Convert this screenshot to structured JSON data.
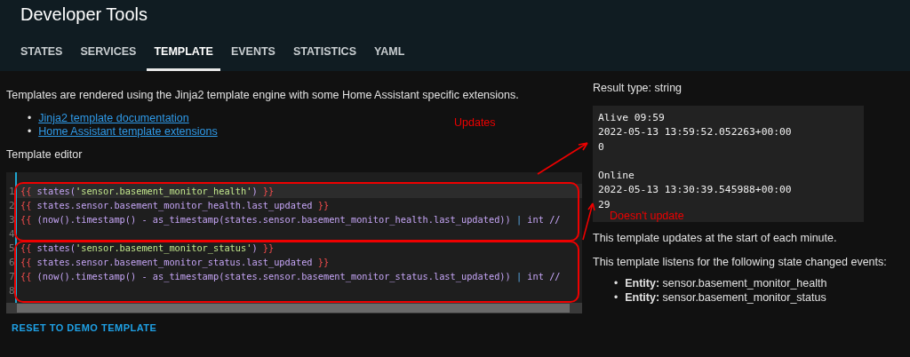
{
  "header": {
    "title": "Developer Tools"
  },
  "tabs": [
    {
      "label": "STATES",
      "selected": false
    },
    {
      "label": "SERVICES",
      "selected": false
    },
    {
      "label": "TEMPLATE",
      "selected": true
    },
    {
      "label": "EVENTS",
      "selected": false
    },
    {
      "label": "STATISTICS",
      "selected": false
    },
    {
      "label": "YAML",
      "selected": false
    }
  ],
  "intro": "Templates are rendered using the Jinja2 template engine with some Home Assistant specific extensions.",
  "links": [
    {
      "marker": "•",
      "text": "Jinja2 template documentation"
    },
    {
      "marker": "•",
      "text": "Home Assistant template extensions"
    }
  ],
  "editor_label": "Template editor",
  "editor": {
    "lines": [
      {
        "number": "1",
        "active": true,
        "segments": [
          {
            "kind": "brace",
            "text": "{{"
          },
          {
            "kind": "code",
            "text": " states("
          },
          {
            "kind": "string",
            "text": "'sensor.basement_monitor_health'"
          },
          {
            "kind": "code",
            "text": ") "
          },
          {
            "kind": "brace",
            "text": "}}"
          }
        ]
      },
      {
        "number": "2",
        "active": false,
        "segments": [
          {
            "kind": "brace",
            "text": "{{"
          },
          {
            "kind": "code",
            "text": " states.sensor.basement_monitor_health.last_updated "
          },
          {
            "kind": "brace",
            "text": "}}"
          }
        ]
      },
      {
        "number": "3",
        "active": false,
        "segments": [
          {
            "kind": "brace",
            "text": "{{"
          },
          {
            "kind": "code",
            "text": " (now().timestamp() - as_timestamp(states.sensor.basement_monitor_health.last_updated)) "
          },
          {
            "kind": "pipe",
            "text": "|"
          },
          {
            "kind": "code",
            "text": " int //"
          }
        ]
      },
      {
        "number": "4",
        "active": false
      },
      {
        "number": "5",
        "active": false,
        "segments": [
          {
            "kind": "brace",
            "text": "{{"
          },
          {
            "kind": "code",
            "text": " states("
          },
          {
            "kind": "string",
            "text": "'sensor.basement_monitor_status'"
          },
          {
            "kind": "code",
            "text": ") "
          },
          {
            "kind": "brace",
            "text": "}}"
          }
        ]
      },
      {
        "number": "6",
        "active": false,
        "segments": [
          {
            "kind": "brace",
            "text": "{{"
          },
          {
            "kind": "code",
            "text": " states.sensor.basement_monitor_status.last_updated "
          },
          {
            "kind": "brace",
            "text": "}}"
          }
        ]
      },
      {
        "number": "7",
        "active": false,
        "segments": [
          {
            "kind": "brace",
            "text": "{{"
          },
          {
            "kind": "code",
            "text": " (now().timestamp() - as_timestamp(states.sensor.basement_monitor_status.last_updated)) "
          },
          {
            "kind": "pipe",
            "text": "|"
          },
          {
            "kind": "code",
            "text": " int //"
          }
        ]
      },
      {
        "number": "8",
        "active": false
      }
    ]
  },
  "reset_button": "RESET TO DEMO TEMPLATE",
  "result": {
    "type_label": "Result type: string",
    "blocks": [
      [
        "Alive 09:59",
        "2022-05-13 13:59:52.052263+00:00",
        "0"
      ],
      [
        "Online",
        "2022-05-13 13:30:39.545988+00:00",
        "29"
      ]
    ]
  },
  "update_note": "This template updates at the start of each minute.",
  "listen_note": "This template listens for the following state changed events:",
  "entities": [
    {
      "marker": "•",
      "text": "**Entity:** sensor.basement_monitor_health"
    },
    {
      "marker": "•",
      "text": "**Entity:** sensor.basement_monitor_status"
    }
  ],
  "annotations": [
    {
      "kind": "updates",
      "text": "Updates"
    },
    {
      "kind": "no-update",
      "text": "Doesn't update"
    }
  ]
}
